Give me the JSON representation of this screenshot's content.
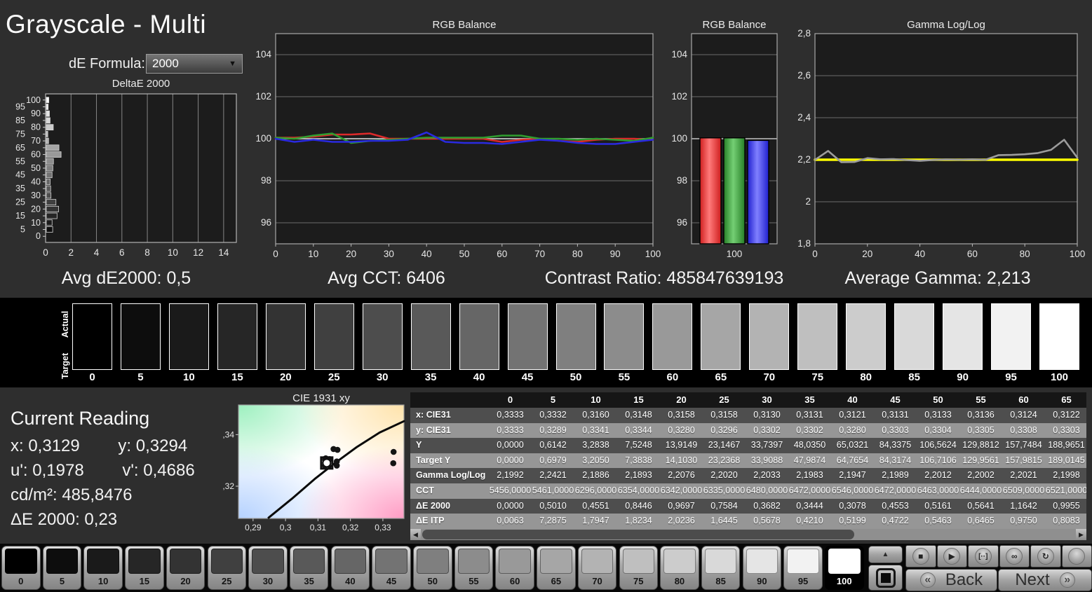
{
  "header": {
    "title": "Grayscale - Multi",
    "de_formula_label": "dE Formula:",
    "de_formula_value": "2000"
  },
  "stats": [
    {
      "text": "Avg dE2000: 0,5"
    },
    {
      "text": "Avg CCT: 6406"
    },
    {
      "text": "Contrast Ratio: 485847639193"
    },
    {
      "text": "Average Gamma: 2,213"
    }
  ],
  "swatch_strip": {
    "row_label_top": "Actual",
    "row_label_bottom": "Target",
    "levels": [
      0,
      5,
      10,
      15,
      20,
      25,
      30,
      35,
      40,
      45,
      50,
      55,
      60,
      65,
      70,
      75,
      80,
      85,
      90,
      95,
      100
    ]
  },
  "current_reading": {
    "title": "Current Reading",
    "lines": [
      "x: 0,3129",
      "y: 0,3294",
      "u': 0,1978",
      "v': 0,4686",
      "cd/m²: 485,8476",
      "ΔE 2000: 0,23"
    ]
  },
  "table": {
    "col_headers": [
      "",
      "0",
      "5",
      "10",
      "15",
      "20",
      "25",
      "30",
      "35",
      "40",
      "45",
      "50",
      "55",
      "60",
      "65"
    ],
    "rows": [
      {
        "label": "x: CIE31",
        "values": [
          "0,3333",
          "0,3332",
          "0,3160",
          "0,3148",
          "0,3158",
          "0,3158",
          "0,3130",
          "0,3131",
          "0,3121",
          "0,3131",
          "0,3133",
          "0,3136",
          "0,3124",
          "0,3122"
        ]
      },
      {
        "label": "y: CIE31",
        "values": [
          "0,3333",
          "0,3289",
          "0,3341",
          "0,3344",
          "0,3280",
          "0,3296",
          "0,3302",
          "0,3302",
          "0,3280",
          "0,3303",
          "0,3304",
          "0,3305",
          "0,3308",
          "0,3303"
        ]
      },
      {
        "label": "Y",
        "values": [
          "0,0000",
          "0,6142",
          "3,2838",
          "7,5248",
          "13,9149",
          "23,1467",
          "33,7397",
          "48,0350",
          "65,0321",
          "84,3375",
          "106,5624",
          "129,8812",
          "157,7484",
          "188,9651"
        ]
      },
      {
        "label": "Target Y",
        "values": [
          "0,0000",
          "0,6979",
          "3,2050",
          "7,3838",
          "14,1030",
          "23,2368",
          "33,9088",
          "47,9874",
          "64,7654",
          "84,3174",
          "106,7106",
          "129,9561",
          "157,9815",
          "189,0145"
        ]
      },
      {
        "label": "Gamma Log/Log",
        "values": [
          "2,1992",
          "2,2421",
          "2,1886",
          "2,1893",
          "2,2076",
          "2,2020",
          "2,2033",
          "2,1983",
          "2,1947",
          "2,1989",
          "2,2012",
          "2,2002",
          "2,2021",
          "2,1998"
        ]
      },
      {
        "label": "CCT",
        "values": [
          "5456,0000",
          "5461,0000",
          "6296,0000",
          "6354,0000",
          "6342,0000",
          "6335,0000",
          "6480,0000",
          "6472,0000",
          "6546,0000",
          "6472,0000",
          "6463,0000",
          "6444,0000",
          "6509,0000",
          "6521,0000"
        ]
      },
      {
        "label": "ΔE 2000",
        "values": [
          "0,0000",
          "0,5010",
          "0,4551",
          "0,8446",
          "0,9697",
          "0,7584",
          "0,3682",
          "0,3444",
          "0,3078",
          "0,4553",
          "0,5161",
          "0,5641",
          "1,1642",
          "0,9955"
        ]
      },
      {
        "label": "ΔE ITP",
        "values": [
          "0,0063",
          "7,2875",
          "1,7947",
          "1,8234",
          "2,0236",
          "1,6445",
          "0,5678",
          "0,4210",
          "0,5199",
          "0,4722",
          "0,5463",
          "0,6465",
          "0,9750",
          "0,8083"
        ]
      }
    ]
  },
  "chart_data": [
    {
      "id": "deltae",
      "type": "bar",
      "orientation": "horizontal",
      "title": "DeltaE 2000",
      "categories": [
        0,
        5,
        10,
        15,
        20,
        25,
        30,
        35,
        40,
        45,
        50,
        55,
        60,
        65,
        70,
        75,
        80,
        85,
        90,
        95,
        100
      ],
      "values": [
        0.0,
        0.501,
        0.4551,
        0.8446,
        0.9697,
        0.7584,
        0.3682,
        0.3444,
        0.3078,
        0.4553,
        0.5161,
        0.5641,
        1.1642,
        0.9955,
        0.18,
        0.12,
        0.55,
        0.3,
        0.25,
        0.15,
        0.2
      ],
      "xlim": [
        0,
        15
      ],
      "xticks": [
        0,
        2,
        4,
        6,
        8,
        10,
        12,
        14
      ],
      "grid": true
    },
    {
      "id": "rgb-balance-line",
      "type": "line",
      "title": "RGB Balance",
      "x": [
        0,
        5,
        10,
        15,
        20,
        25,
        30,
        35,
        40,
        45,
        50,
        55,
        60,
        65,
        70,
        75,
        80,
        85,
        90,
        95,
        100
      ],
      "ylim": [
        95,
        105
      ],
      "yticks": [
        96,
        98,
        100,
        102,
        104
      ],
      "xticks": [
        0,
        10,
        20,
        30,
        40,
        50,
        60,
        70,
        80,
        90,
        100
      ],
      "target_line": 100,
      "series": [
        {
          "name": "Red",
          "color": "#dd2a2a",
          "values": [
            100.05,
            100.05,
            100.1,
            100.2,
            100.2,
            100.25,
            100.0,
            100.0,
            100.0,
            100.0,
            100.0,
            100.0,
            99.85,
            99.95,
            100.0,
            99.9,
            99.85,
            99.95,
            100.0,
            100.0,
            99.95
          ]
        },
        {
          "name": "Green",
          "color": "#2f9e2f",
          "values": [
            100.05,
            100.0,
            100.15,
            100.25,
            99.8,
            99.9,
            99.95,
            100.0,
            100.05,
            100.05,
            100.05,
            100.05,
            100.15,
            100.15,
            100.0,
            100.0,
            99.95,
            100.0,
            99.95,
            99.9,
            100.05
          ]
        },
        {
          "name": "Blue",
          "color": "#2a2ae0",
          "values": [
            100.0,
            99.85,
            99.95,
            99.85,
            99.85,
            99.9,
            99.9,
            99.95,
            100.3,
            99.85,
            99.8,
            99.8,
            99.75,
            99.85,
            99.95,
            99.9,
            99.8,
            99.75,
            99.75,
            99.85,
            99.95
          ]
        }
      ]
    },
    {
      "id": "rgb-balance-bars",
      "type": "bar",
      "title": "RGB Balance",
      "categories": [
        "100"
      ],
      "ylim": [
        95,
        105
      ],
      "yticks": [
        96,
        98,
        100,
        102,
        104
      ],
      "series": [
        {
          "name": "Red",
          "color": "#dd2a2a",
          "values": [
            100.04
          ]
        },
        {
          "name": "Green",
          "color": "#2f9e2f",
          "values": [
            100.04
          ]
        },
        {
          "name": "Blue",
          "color": "#2a2ae0",
          "values": [
            99.92
          ]
        }
      ]
    },
    {
      "id": "gamma",
      "type": "line",
      "title": "Gamma Log/Log",
      "x": [
        0,
        5,
        10,
        15,
        20,
        25,
        30,
        35,
        40,
        45,
        50,
        55,
        60,
        65,
        70,
        75,
        80,
        85,
        90,
        95,
        100
      ],
      "ylim": [
        1.8,
        2.8
      ],
      "yticks": [
        {
          "v": 2.8,
          "label": "2,8"
        },
        {
          "v": 2.6,
          "label": "2,6"
        },
        {
          "v": 2.4,
          "label": "2,4"
        },
        {
          "v": 2.2,
          "label": "2,2"
        },
        {
          "v": 2.0,
          "label": "2"
        },
        {
          "v": 1.8,
          "label": "1,8"
        }
      ],
      "xticks": [
        0,
        20,
        40,
        60,
        80,
        100
      ],
      "target_value": 2.2,
      "target_color": "#ffff00",
      "measured_color": "#9c9c9c",
      "measured": [
        2.1992,
        2.2421,
        2.1886,
        2.1893,
        2.2076,
        2.202,
        2.2033,
        2.1983,
        2.1947,
        2.1989,
        2.2012,
        2.2002,
        2.2021,
        2.1998,
        2.222,
        2.223,
        2.226,
        2.232,
        2.247,
        2.295,
        2.21
      ]
    },
    {
      "id": "cie",
      "type": "scatter",
      "title": "CIE 1931 xy",
      "xlim": [
        0.2855,
        0.3365
      ],
      "ylim": [
        0.3075,
        0.3515
      ],
      "xticks": [
        {
          "v": 0.29,
          "label": "0,29"
        },
        {
          "v": 0.3,
          "label": "0,3"
        },
        {
          "v": 0.31,
          "label": "0,31"
        },
        {
          "v": 0.32,
          "label": "0,32"
        },
        {
          "v": 0.33,
          "label": "0,33"
        }
      ],
      "yticks": [
        {
          "v": 0.34,
          "label": "0,34"
        },
        {
          "v": 0.32,
          "label": "0,32"
        }
      ],
      "points": [
        [
          0.3333,
          0.3333
        ],
        [
          0.3332,
          0.3289
        ],
        [
          0.316,
          0.3341
        ],
        [
          0.3148,
          0.3344
        ],
        [
          0.3158,
          0.328
        ],
        [
          0.3158,
          0.3296
        ],
        [
          0.313,
          0.3302
        ],
        [
          0.3131,
          0.3302
        ],
        [
          0.3121,
          0.328
        ],
        [
          0.3131,
          0.3303
        ],
        [
          0.3133,
          0.3304
        ],
        [
          0.3136,
          0.3305
        ],
        [
          0.3124,
          0.3308
        ],
        [
          0.3122,
          0.3303
        ],
        [
          0.3129,
          0.3294
        ],
        [
          0.3127,
          0.3298
        ],
        [
          0.3125,
          0.3291
        ],
        [
          0.3131,
          0.3296
        ],
        [
          0.3128,
          0.33
        ],
        [
          0.3126,
          0.3293
        ]
      ],
      "target": [
        0.3127,
        0.329
      ],
      "locus": [
        [
          0.2948,
          0.3078
        ],
        [
          0.302,
          0.3152
        ],
        [
          0.309,
          0.3228
        ],
        [
          0.3155,
          0.3292
        ],
        [
          0.322,
          0.3352
        ],
        [
          0.329,
          0.3408
        ],
        [
          0.3365,
          0.3452
        ]
      ]
    }
  ],
  "bottom_bar": {
    "patches": [
      0,
      5,
      10,
      15,
      20,
      25,
      30,
      35,
      40,
      45,
      50,
      55,
      60,
      65,
      70,
      75,
      80,
      85,
      90,
      95,
      100
    ],
    "selected_patch": 100,
    "up_glyph": "▲",
    "media_controls": [
      {
        "name": "stop",
        "glyph": "■"
      },
      {
        "name": "play",
        "glyph": "▶"
      },
      {
        "name": "range-marker",
        "glyph": "[··]"
      },
      {
        "name": "infinity-loop",
        "glyph": "∞"
      },
      {
        "name": "refresh-loop",
        "glyph": "↻"
      },
      {
        "name": "record-blank",
        "glyph": ""
      }
    ],
    "back_label": "Back",
    "next_label": "Next",
    "back_glyph": "«",
    "next_glyph": "»"
  }
}
